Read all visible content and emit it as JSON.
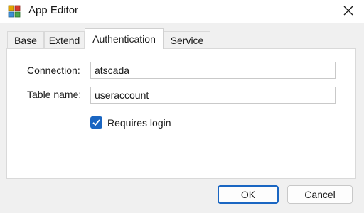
{
  "window": {
    "title": "App Editor",
    "icon": "app-editor-icon",
    "close_icon": "close-icon"
  },
  "tabs": [
    {
      "label": "Base",
      "active": false
    },
    {
      "label": "Extend",
      "active": false
    },
    {
      "label": "Authentication",
      "active": true
    },
    {
      "label": "Service",
      "active": false
    }
  ],
  "form": {
    "connection_label": "Connection:",
    "connection_value": "atscada",
    "table_label": "Table name:",
    "table_value": "useraccount",
    "requires_login_label": "Requires login",
    "requires_login_checked": true
  },
  "buttons": {
    "ok_label": "OK",
    "cancel_label": "Cancel"
  },
  "colors": {
    "accent": "#1a66c2",
    "dialog_bg": "#f0f0f0",
    "panel_bg": "#ffffff"
  }
}
